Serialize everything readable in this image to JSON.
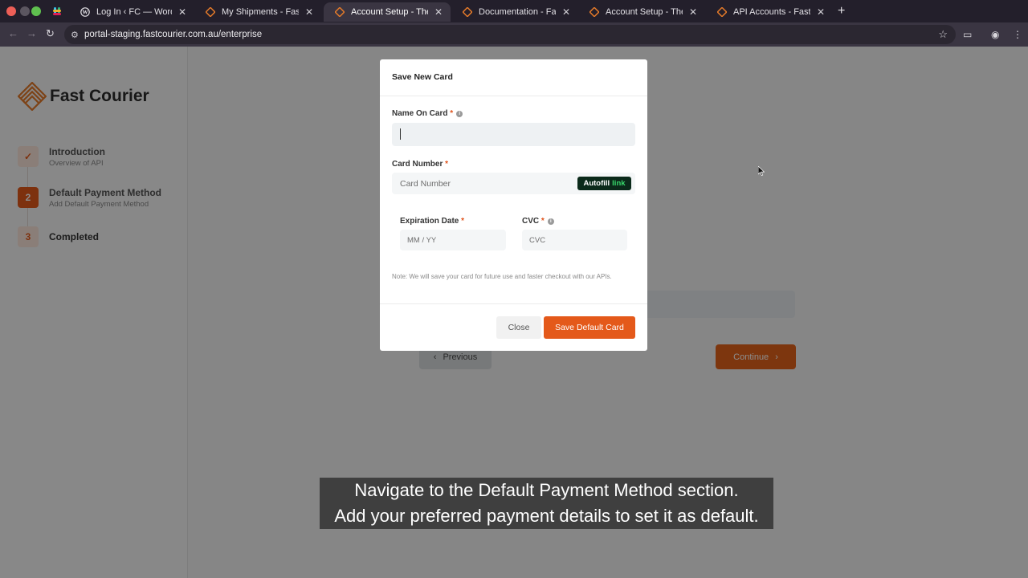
{
  "browser": {
    "tabs": [
      {
        "label": "Log In ‹ FC — WordPress",
        "icon": "wordpress-icon"
      },
      {
        "label": "My Shipments - FastCourier",
        "icon": "fastcourier-icon"
      },
      {
        "label": "Account Setup - The Fast Co",
        "icon": "fastcourier-icon",
        "active": true
      },
      {
        "label": "Documentation - FastCourier",
        "icon": "fastcourier-icon"
      },
      {
        "label": "Account Setup - The Fast Co",
        "icon": "fastcourier-icon"
      },
      {
        "label": "API Accounts - Fastcourier-A",
        "icon": "fastcourier-icon"
      }
    ],
    "url": "portal-staging.fastcourier.com.au/enterprise"
  },
  "sidebar": {
    "brand": "Fast Courier",
    "steps": [
      {
        "num": "✓",
        "title": "Introduction",
        "subtitle": "Overview of API"
      },
      {
        "num": "2",
        "title": "Default Payment Method",
        "subtitle": "Add Default Payment Method"
      },
      {
        "num": "3",
        "title": "Completed",
        "subtitle": ""
      }
    ]
  },
  "main": {
    "previous_label": "Previous",
    "continue_label": "Continue"
  },
  "modal": {
    "title": "Save New Card",
    "name_label": "Name On Card",
    "card_number_label": "Card Number",
    "card_number_placeholder": "Card Number",
    "autofill_text": "Autofill",
    "autofill_link": "link",
    "expiry_label": "Expiration Date",
    "expiry_placeholder": "MM / YY",
    "cvc_label": "CVC",
    "cvc_placeholder": "CVC",
    "required_mark": "*",
    "note": "Note: We will save your card for future use and faster checkout with our APIs.",
    "close_label": "Close",
    "save_label": "Save Default Card"
  },
  "caption": {
    "line1": "Navigate to the Default Payment Method section.",
    "line2": "Add your preferred payment details to set it as default."
  },
  "colors": {
    "accent": "#e4591a",
    "autofill_bg": "#0b2a1a",
    "autofill_link": "#39d96c"
  }
}
